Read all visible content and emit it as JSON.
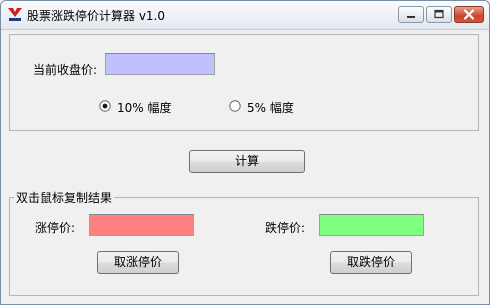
{
  "window": {
    "title": "股票涨跌停价计算器 v1.0"
  },
  "input_group": {
    "close_price_label": "当前收盘价:",
    "close_price_value": "",
    "close_price_color": "#c0c0ff",
    "options": [
      {
        "label": "10% 幅度",
        "selected": true
      },
      {
        "label": "5% 幅度",
        "selected": false
      }
    ]
  },
  "calculate_button": "计算",
  "result_group": {
    "legend": "双击鼠标复制结果",
    "limit_up_label": "涨停价:",
    "limit_up_value": "",
    "limit_up_color": "#ff8080",
    "limit_down_label": "跌停价:",
    "limit_down_value": "",
    "limit_down_color": "#80ff80",
    "get_limit_up_button": "取涨停价",
    "get_limit_down_button": "取跌停价"
  }
}
